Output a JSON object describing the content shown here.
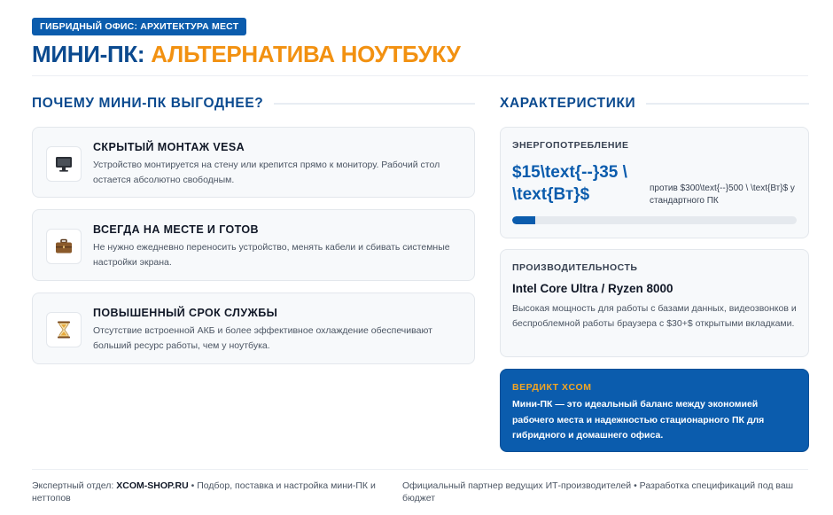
{
  "header": {
    "badge": "ГИБРИДНЫЙ ОФИС: АРХИТЕКТУРА МЕСТ",
    "title_part1": "МИНИ-ПК:",
    "title_part2": "АЛЬТЕРНАТИВА НОУТБУКУ"
  },
  "left_section": {
    "heading": "ПОЧЕМУ МИНИ-ПК ВЫГОДНЕЕ?",
    "features": [
      {
        "icon": "monitor-icon",
        "title": "СКРЫТЫЙ МОНТАЖ VESA",
        "description": "Устройство монтируется на стену или крепится прямо к монитору. Рабочий стол остается абсолютно свободным."
      },
      {
        "icon": "briefcase-icon",
        "title": "ВСЕГДА НА МЕСТЕ И ГОТОВ",
        "description": "Не нужно ежедневно переносить устройство, менять кабели и сбивать системные настройки экрана."
      },
      {
        "icon": "hourglass-icon",
        "title": "ПОВЫШЕННЫЙ СРОК СЛУЖБЫ",
        "description": "Отсутствие встроенной АКБ и более эффективное охлаждение обеспечивают больший ресурс работы, чем у ноутбука."
      }
    ]
  },
  "right_section": {
    "heading": "ХАРАКТЕРИСТИКИ",
    "power": {
      "label": "ЭНЕРГОПОТРЕБЛЕНИЕ",
      "value": "$15\\text{--}35 \\ \\text{Вт}$",
      "compare": "против $300\\text{--}500 \\ \\text{Вт}$ у стандартного ПК",
      "bar_fraction": 0.08
    },
    "performance": {
      "label": "ПРОИЗВОДИТЕЛЬНОСТЬ",
      "cpu": "Intel Core Ultra / Ryzen 8000",
      "description": "Высокая мощность для работы с базами данных, видеозвонков и беспроблемной работы браузера с $30+$ открытыми вкладками."
    },
    "verdict": {
      "label": "ВЕРДИКТ XCOM",
      "text": "Мини-ПК — это идеальный баланс между экономией рабочего места и надежностью стационарного ПК для гибридного и домашнего офиса."
    }
  },
  "footer": {
    "left_prefix": "Экспертный отдел:",
    "left_brand": "XCOM-SHOP.RU",
    "left_suffix": "• Подбор, поставка и настройка мини-ПК и неттопов",
    "right": "Официальный партнер ведущих ИТ-производителей • Разработка спецификаций под ваш бюджет"
  },
  "colors": {
    "brand_blue": "#0b5cad",
    "accent_orange": "#f29111"
  }
}
